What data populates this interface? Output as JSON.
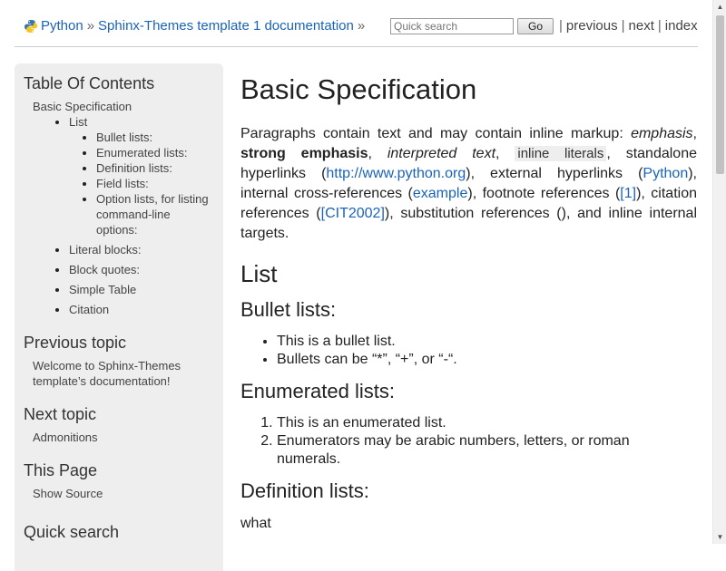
{
  "header": {
    "crumbs": [
      {
        "label": "Python"
      },
      {
        "label": "Sphinx-Themes template 1 documentation"
      }
    ],
    "separator": "»",
    "search_placeholder": "Quick search",
    "go_label": "Go",
    "relnav": [
      "previous",
      "next",
      "index"
    ],
    "relnav_separator": "|"
  },
  "sidebar": {
    "toc_title": "Table Of Contents",
    "toc": {
      "root": "Basic Specification",
      "list_label": "List",
      "list_children": [
        "Bullet lists:",
        "Enumerated lists:",
        "Definition lists:",
        "Field lists:",
        "Option lists, for listing command-line options:"
      ],
      "others": [
        "Literal blocks:",
        "Block quotes:",
        "Simple Table",
        "Citation"
      ]
    },
    "prev_title": "Previous topic",
    "prev_link": "Welcome to Sphinx-Themes template’s documentation!",
    "next_title": "Next topic",
    "next_link": "Admonitions",
    "this_page_title": "This Page",
    "show_source": "Show Source",
    "quick_search_title": "Quick search"
  },
  "main": {
    "title": "Basic Specification",
    "intro": {
      "t1": "Paragraphs contain text and may contain inline markup: ",
      "emphasis": "emphasis",
      "comma": ", ",
      "strong": "strong emphasis",
      "interpreted": "interpreted text",
      "literal": "inline literals",
      "t2": ", standalone hyperlinks (",
      "link_url": "http://www.python.org",
      "t3": "), external hyperlinks (",
      "link_python": "Python",
      "t4": "), internal cross-references (",
      "link_example": "example",
      "t5": "), footnote references (",
      "link_fn": "[1]",
      "t6": "), citation references (",
      "link_cit": "[CIT2002]",
      "t7": "), substitution references (), and inline internal targets."
    },
    "list_heading": "List",
    "bullet_heading": "Bullet lists:",
    "bullets": [
      "This is a bullet list.",
      "Bullets can be “*”, “+”, or “-“."
    ],
    "enum_heading": "Enumerated lists:",
    "enums": [
      "This is an enumerated list.",
      "Enumerators may be arabic numbers, letters, or roman numerals."
    ],
    "def_heading": "Definition lists:",
    "def_term_partial": "what"
  },
  "colors": {
    "link": "#1a63b8",
    "sidebar_bg": "#eeeeee"
  }
}
